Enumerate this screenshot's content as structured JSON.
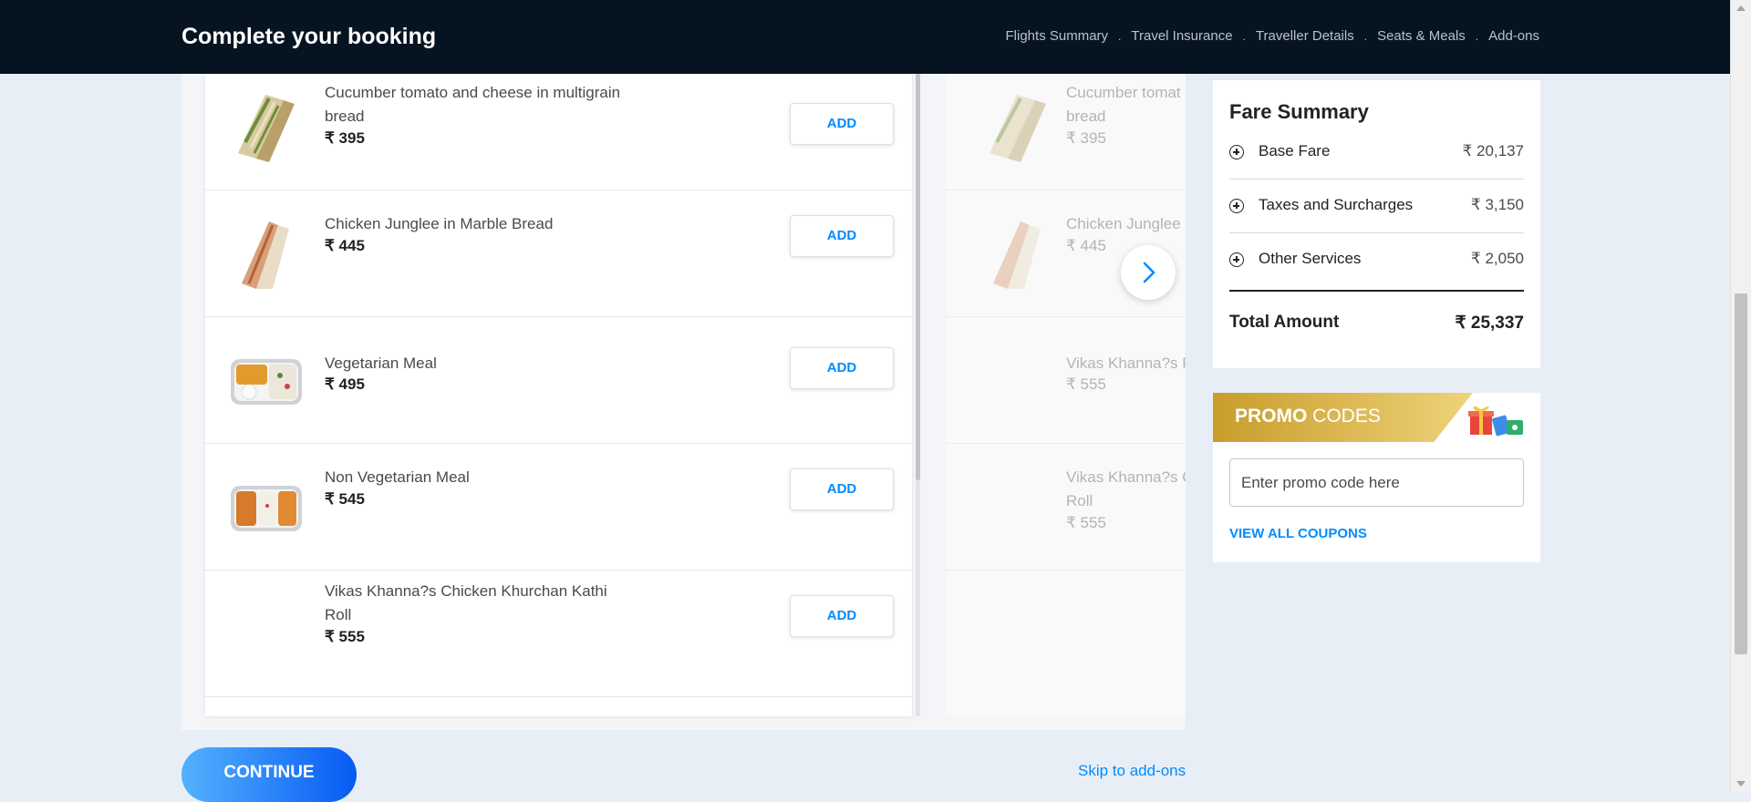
{
  "header": {
    "title": "Complete your booking",
    "steps": [
      "Flights Summary",
      "Travel Insurance",
      "Traveller Details",
      "Seats & Meals",
      "Add-ons"
    ],
    "separator": "."
  },
  "meals": [
    {
      "name": "Cucumber tomato and cheese in multigrain bread",
      "price": "₹ 395",
      "button": "ADD",
      "image": "sandwich"
    },
    {
      "name": "Chicken Junglee in Marble Bread",
      "price": "₹ 445",
      "button": "ADD",
      "image": "sandwich"
    },
    {
      "name": "Vegetarian Meal",
      "price": "₹ 495",
      "button": "ADD",
      "image": "meal-tray"
    },
    {
      "name": "Non Vegetarian Meal",
      "price": "₹ 545",
      "button": "ADD",
      "image": "meal-tray"
    },
    {
      "name": "Vikas Khanna?s Chicken Khurchan Kathi Roll",
      "price": "₹ 555",
      "button": "ADD",
      "image": "none"
    }
  ],
  "faded_meals": [
    {
      "name_line1": "Cucumber tomat",
      "name_line2": "bread",
      "price": "₹ 395"
    },
    {
      "name_line1": "Chicken Junglee i",
      "name_line2": "",
      "price": "₹ 445"
    },
    {
      "name_line1": "Vikas Khanna?s P",
      "name_line2": "",
      "price": "₹ 555"
    },
    {
      "name_line1": "Vikas Khanna?s C",
      "name_line2": "Roll",
      "price": "₹ 555"
    }
  ],
  "actions": {
    "continue": "CONTINUE",
    "skip": "Skip to add-ons"
  },
  "fare": {
    "title": "Fare Summary",
    "rows": [
      {
        "label": "Base Fare",
        "value": "₹ 20,137"
      },
      {
        "label": "Taxes and Surcharges",
        "value": "₹ 3,150"
      },
      {
        "label": "Other Services",
        "value": "₹ 2,050"
      }
    ],
    "total_label": "Total Amount",
    "total_value": "₹ 25,337"
  },
  "promo": {
    "title_bold": "PROMO",
    "title_rest": " CODES",
    "placeholder": "Enter promo code here",
    "view_all": "VIEW ALL COUPONS"
  },
  "colors": {
    "header_bg": "#061422",
    "accent_blue": "#008cff",
    "page_bg": "#e7eef6",
    "promo_gold": "#c89d2c"
  }
}
